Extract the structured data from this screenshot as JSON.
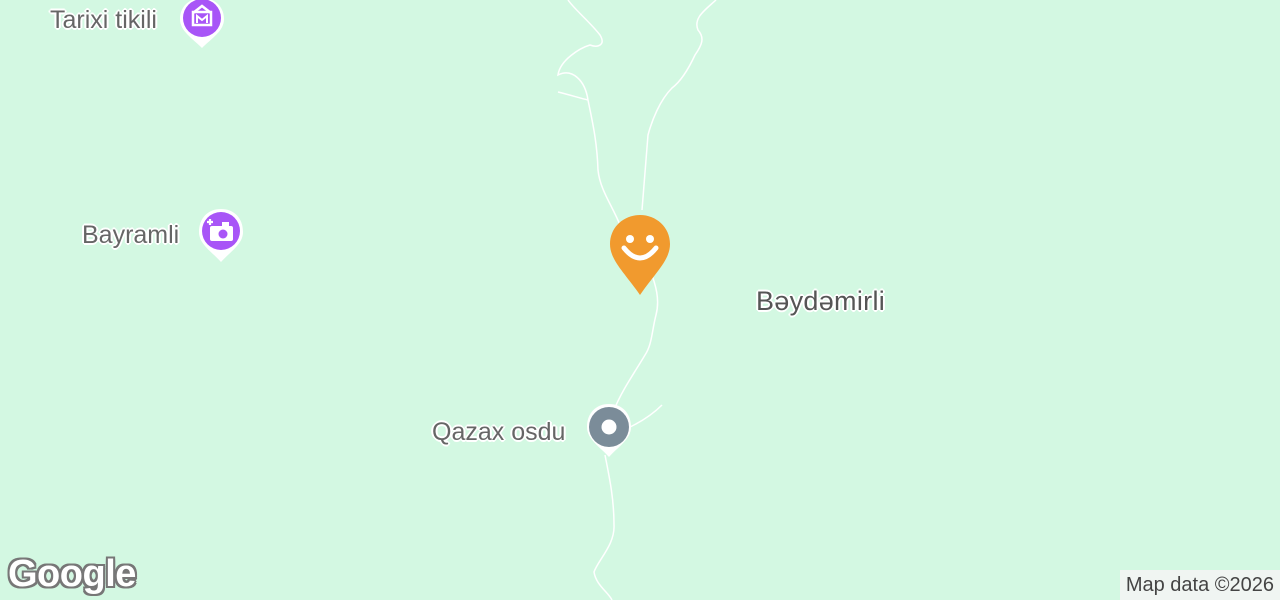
{
  "map": {
    "places": [
      {
        "label": "Tarixi tikili",
        "icon": "museum-icon",
        "color": "#a855f7"
      },
      {
        "label": "Bayramli",
        "icon": "camera-icon",
        "color": "#a855f7"
      },
      {
        "label": "Qazax osdu",
        "icon": "generic-pin-icon",
        "color": "#7b8c99"
      }
    ],
    "selected_pin": {
      "icon": "smiley-icon",
      "color": "#f19a2e"
    },
    "area_label": "Bəydəmirli"
  },
  "footer": {
    "logo_text": "Google",
    "attribution": "Map data ©2026"
  }
}
